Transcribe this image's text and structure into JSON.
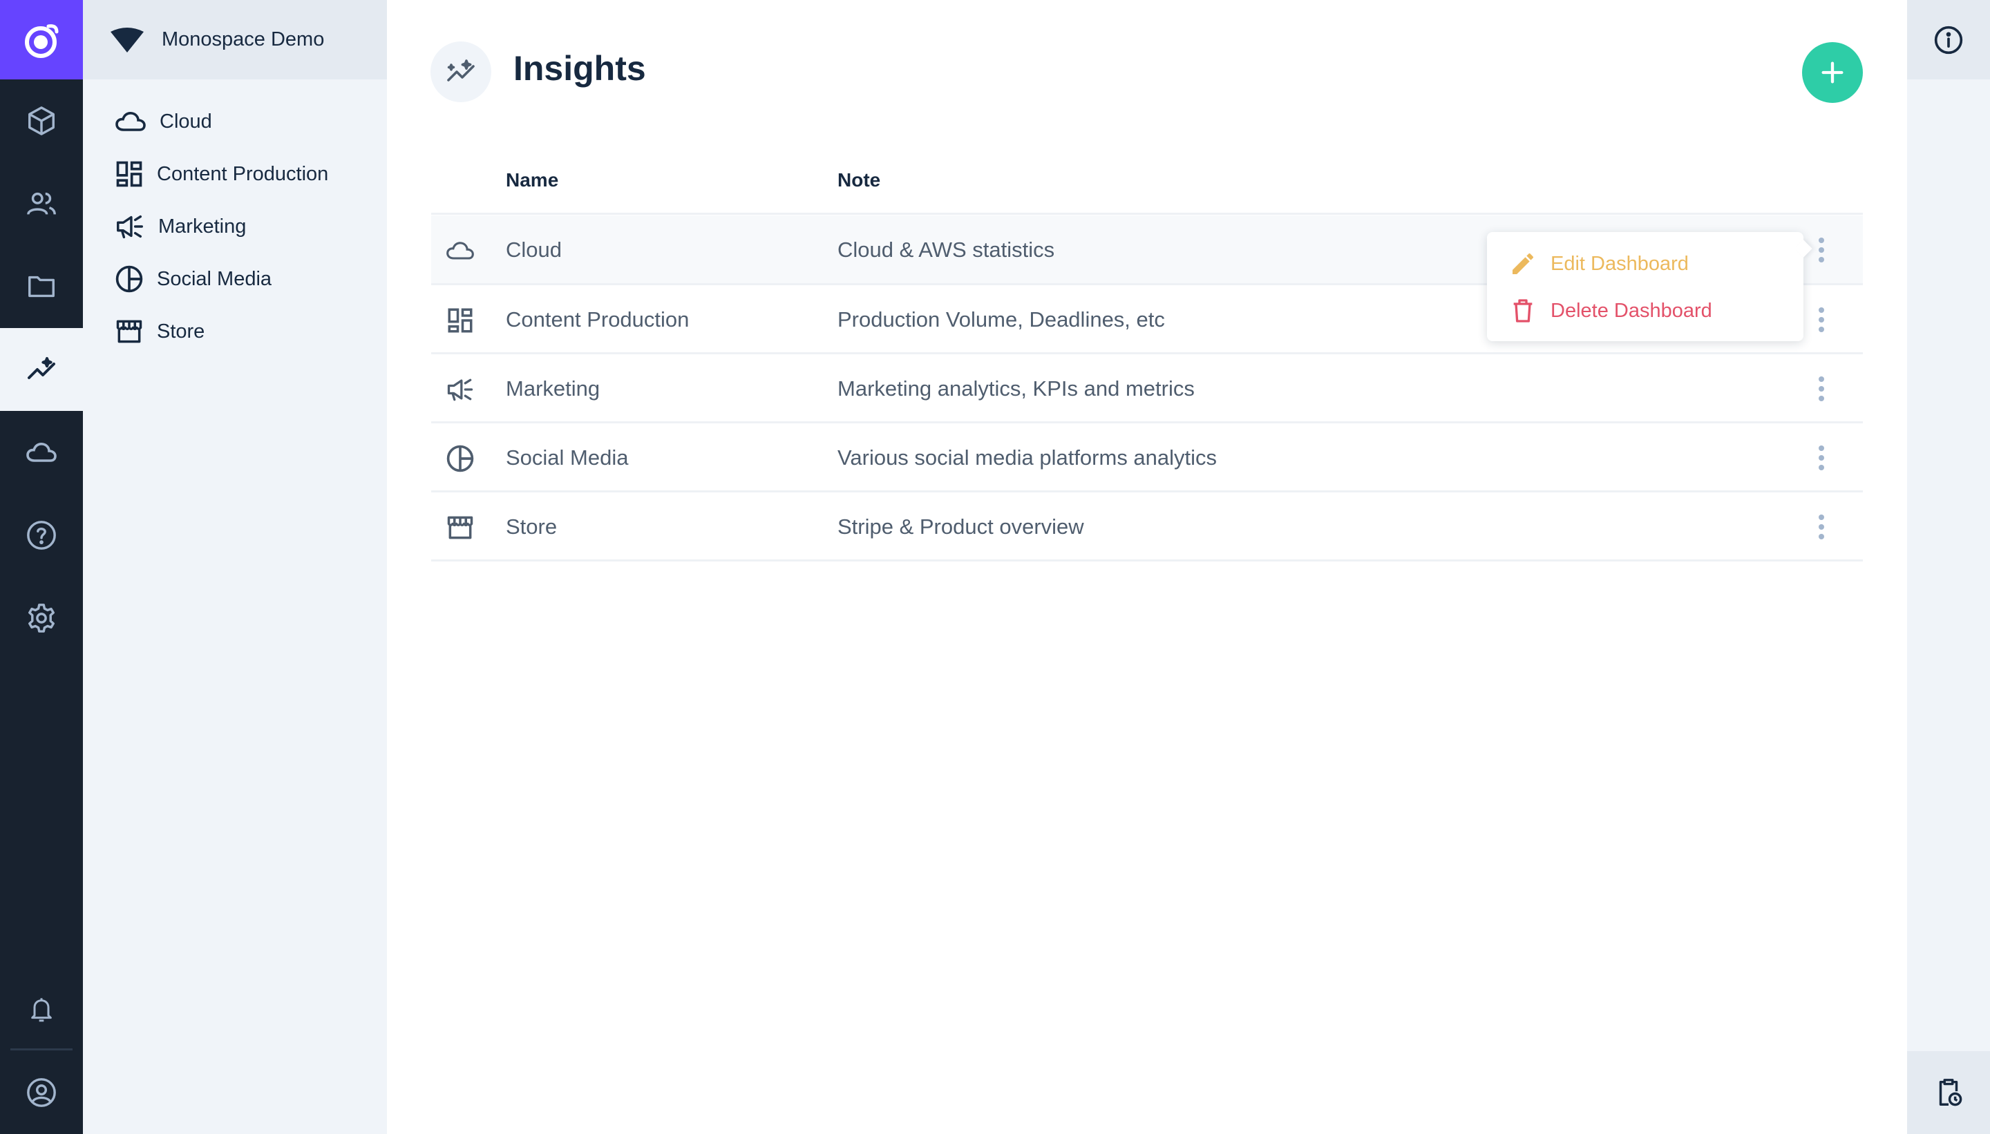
{
  "project": {
    "name": "Monospace Demo"
  },
  "module_bar": {
    "items": [
      {
        "icon": "box-icon",
        "label": "Content"
      },
      {
        "icon": "users-icon",
        "label": "User Directory"
      },
      {
        "icon": "folder-icon",
        "label": "File Library"
      },
      {
        "icon": "insights-icon",
        "label": "Insights",
        "active": true
      },
      {
        "icon": "cloud-icon",
        "label": "Cloud"
      },
      {
        "icon": "help-icon",
        "label": "Documentation"
      },
      {
        "icon": "gear-icon",
        "label": "Settings"
      }
    ]
  },
  "nav": {
    "items": [
      {
        "icon": "cloud-icon",
        "label": "Cloud"
      },
      {
        "icon": "dashboard-icon",
        "label": "Content Production"
      },
      {
        "icon": "campaign-icon",
        "label": "Marketing"
      },
      {
        "icon": "pie-chart-icon",
        "label": "Social Media"
      },
      {
        "icon": "store-icon",
        "label": "Store"
      }
    ]
  },
  "header": {
    "title": "Insights"
  },
  "table": {
    "columns": {
      "name": "Name",
      "note": "Note"
    },
    "rows": [
      {
        "icon": "cloud-icon",
        "name": "Cloud",
        "note": "Cloud & AWS statistics"
      },
      {
        "icon": "dashboard-icon",
        "name": "Content Production",
        "note": "Production Volume, Deadlines, etc"
      },
      {
        "icon": "campaign-icon",
        "name": "Marketing",
        "note": "Marketing analytics, KPIs and metrics"
      },
      {
        "icon": "pie-chart-icon",
        "name": "Social Media",
        "note": "Various social media platforms analytics"
      },
      {
        "icon": "store-icon",
        "name": "Store",
        "note": "Stripe & Product overview"
      }
    ]
  },
  "context_menu": {
    "edit_label": "Edit Dashboard",
    "delete_label": "Delete Dashboard"
  },
  "colors": {
    "accent": "#6644ff",
    "primary_action": "#2ecda7",
    "warning": "#ecb95d",
    "danger": "#e35169",
    "rail_bg": "#18222f"
  }
}
